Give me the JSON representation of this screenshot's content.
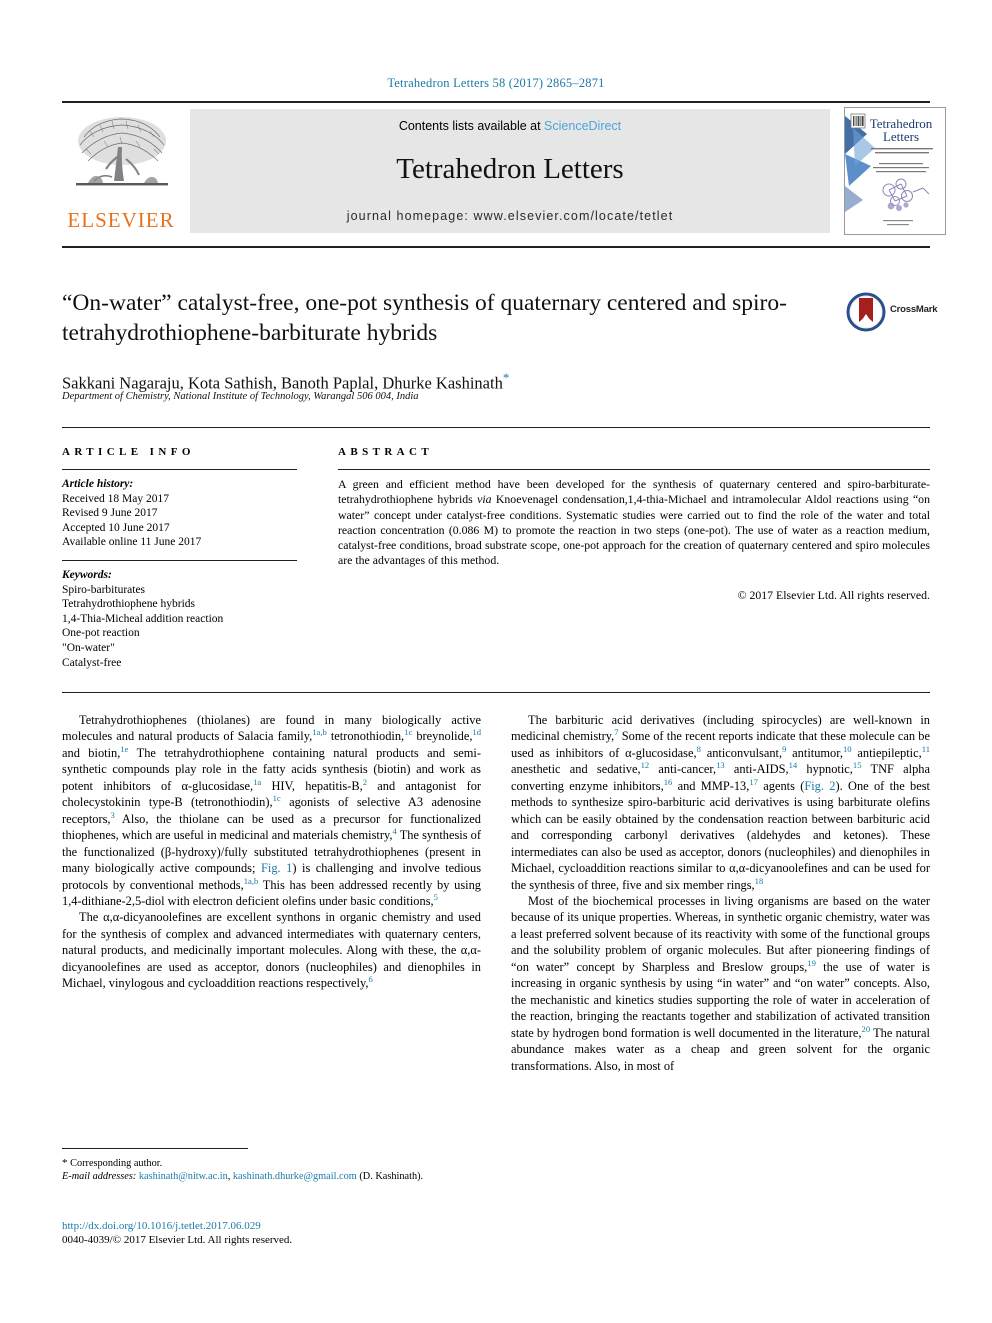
{
  "running_head": "Tetrahedron Letters 58 (2017) 2865–2871",
  "masthead": {
    "contents_prefix": "Contents lists available at ",
    "sciencedirect": "ScienceDirect",
    "journal_name": "Tetrahedron Letters",
    "homepage": "journal homepage: www.elsevier.com/locate/tetlet",
    "publisher_wordmark": "ELSEVIER",
    "cover_title_line1": "Tetrahedron",
    "cover_title_line2": "Letters",
    "accent_link_color": "#4ca6d8",
    "publisher_color": "#E9711C",
    "panel_color": "#e6e6e6"
  },
  "article": {
    "title": "“On-water” catalyst-free, one-pot synthesis of quaternary centered and spiro-tetrahydrothiophene-barbiturate hybrids",
    "authors": "Sakkani Nagaraju, Kota Sathish, Banoth Paplal, Dhurke Kashinath",
    "corresponding_marker": "*",
    "affiliation": "Department of Chemistry, National Institute of Technology, Warangal 506 004, India",
    "crossmark_label": "CrossMark"
  },
  "info": {
    "heading": "ARTICLE INFO",
    "history_label": "Article history:",
    "history": [
      "Received 18 May 2017",
      "Revised 9 June 2017",
      "Accepted 10 June 2017",
      "Available online 11 June 2017"
    ],
    "keywords_label": "Keywords:",
    "keywords": [
      "Spiro-barbiturates",
      "Tetrahydrothiophene hybrids",
      "1,4-Thia-Micheal addition reaction",
      "One-pot reaction",
      "\"On-water\"",
      "Catalyst-free"
    ]
  },
  "abstract": {
    "heading": "ABSTRACT",
    "part1": "A green and efficient method have been developed for the synthesis of quaternary centered and spiro-barbiturate-tetrahydrothiophene hybrids ",
    "via": "via",
    "part2": " Knoevenagel condensation,1,4-thia-Michael and intramolecular Aldol reactions using “on water” concept under catalyst-free conditions. Systematic studies were carried out to find the role of the water and total reaction concentration (0.086 M) to promote the reaction in two steps (one-pot). The use of water as a reaction medium, catalyst-free conditions, broad substrate scope, one-pot approach for the creation of quaternary centered and spiro molecules are the advantages of this method.",
    "copyright": "© 2017 Elsevier Ltd. All rights reserved."
  },
  "body": {
    "left": {
      "p1_a": "Tetrahydrothiophenes (thiolanes) are found in many biologically active molecules and natural products of Salacia family,",
      "p1_r1": "1a,b",
      "p1_b": " tetronothiodin,",
      "p1_r2": "1c",
      "p1_c": " breynolide,",
      "p1_r3": "1d",
      "p1_d": " and biotin,",
      "p1_r4": "1e",
      "p1_e": " The tetrahydrothiophene containing natural products and semi-synthetic compounds play role in the fatty acids synthesis (biotin) and work as potent inhibitors of α-glucosidase,",
      "p1_r5": "1a",
      "p1_f": " HIV, hepatitis-B,",
      "p1_r6": "2",
      "p1_g": " and antagonist for cholecystokinin type-B (tetronothiodin),",
      "p1_r7": "1c",
      "p1_h": " agonists of selective A3 adenosine receptors,",
      "p1_r8": "3",
      "p1_i": " Also, the thiolane can be used as a precursor for functionalized thiophenes, which are useful in medicinal and materials chemistry,",
      "p1_r9": "4",
      "p1_j": " The synthesis of the functionalized (β-hydroxy)/fully substituted tetrahydrothiophenes (present in many biologically active compounds; ",
      "p1_fig": "Fig. 1",
      "p1_k": ") is challenging and involve tedious protocols by conventional methods,",
      "p1_r10": "1a,b",
      "p1_l": " This has been addressed recently by using 1,4-dithiane-2,5-diol with electron deficient olefins under basic conditions,",
      "p1_r11": "5",
      "p2_a": "The α,α-dicyanoolefines are excellent synthons in organic chemistry and used for the synthesis of complex and advanced intermediates with quaternary centers, natural products, and medicinally important molecules. Along with these, the α,α-dicyanoolefines are used as acceptor, donors (nucleophiles) and dienophiles in Michael, vinylogous and cycloaddition reactions respectively,",
      "p2_r1": "6"
    },
    "right": {
      "p1_a": "The barbituric acid derivatives (including spirocycles) are well-known in medicinal chemistry,",
      "p1_r1": "7",
      "p1_b": " Some of the recent reports indicate that these molecule can be used as inhibitors of α-glucosidase,",
      "p1_r2": "8",
      "p1_c": " anticonvulsant,",
      "p1_r3": "9",
      "p1_d": " antitumor,",
      "p1_r4": "10",
      "p1_e": " antiepileptic,",
      "p1_r5": "11",
      "p1_f": " anesthetic and sedative,",
      "p1_r6": "12",
      "p1_g": " anti-cancer,",
      "p1_r7": "13",
      "p1_h": " anti-AIDS,",
      "p1_r8": "14",
      "p1_i": " hypnotic,",
      "p1_r9": "15",
      "p1_j": " TNF alpha converting enzyme inhibitors,",
      "p1_r10": "16",
      "p1_k": " and MMP-13,",
      "p1_r11": "17",
      "p1_l": " agents (",
      "p1_fig": "Fig. 2",
      "p1_m": "). One of the best methods to synthesize spiro-barbituric acid derivatives is using barbiturate olefins which can be easily obtained by the condensation reaction between barbituric acid and corresponding carbonyl derivatives (aldehydes and ketones). These intermediates can also be used as acceptor, donors (nucleophiles) and dienophiles in Michael, cycloaddition reactions similar to α,α-dicyanoolefines and can be used for the synthesis of three, five and six member rings,",
      "p1_r12": "18",
      "p2_a": "Most of the biochemical processes in living organisms are based on the water because of its unique properties. Whereas, in synthetic organic chemistry, water was a least preferred solvent because of its reactivity with some of the functional groups and the solubility problem of organic molecules. But after pioneering findings of “on water” concept by Sharpless and Breslow groups,",
      "p2_r1": "19",
      "p2_b": " the use of water is increasing in organic synthesis by using “in water” and “on water” concepts. Also, the mechanistic and kinetics studies supporting the role of water in acceleration of the reaction, bringing the reactants together and stabilization of activated transition state by hydrogen bond formation is well documented in the literature,",
      "p2_r2": "20",
      "p2_c": " The natural abundance makes water as a cheap and green solvent for the organic transformations. Also, in most of"
    }
  },
  "footer": {
    "corresponding_star": "*",
    "corresponding_text": " Corresponding author.",
    "email_label": "E-mail addresses:",
    "email1": "kashinath@nitw.ac.in",
    "email_sep": ", ",
    "email2": "kashinath.dhurke@gmail.com",
    "email_owner": "(D. Kashinath).",
    "doi": "http://dx.doi.org/10.1016/j.tetlet.2017.06.029",
    "issn_line": "0040-4039/© 2017 Elsevier Ltd. All rights reserved."
  }
}
